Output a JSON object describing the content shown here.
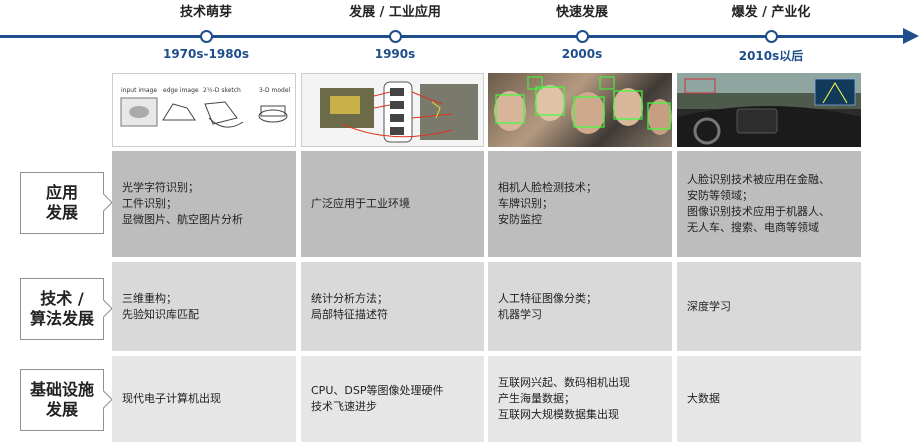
{
  "timeline": {
    "eras": [
      {
        "title": "技术萌芽",
        "year": "1970s-1980s"
      },
      {
        "title": "发展 / 工业应用",
        "year": "1990s"
      },
      {
        "title": "快速发展",
        "year": "2000s"
      },
      {
        "title": "爆发 / 产业化",
        "year": "2010s以后"
      }
    ]
  },
  "thumbs": {
    "t1": {
      "labels": [
        "input image",
        "edge image",
        "2½-D sketch",
        "3-D model"
      ]
    }
  },
  "rows": [
    {
      "label_lines": [
        "应用",
        "发展"
      ],
      "cells": [
        [
          "光学字符识别；",
          "工件识别；",
          "显微图片、航空图片分析"
        ],
        [
          "广泛应用于工业环境"
        ],
        [
          "相机人脸检测技术；",
          "车牌识别；",
          "安防监控"
        ],
        [
          "人脸识别技术被应用在金融、",
          "安防等领域；",
          "图像识别技术应用于机器人、",
          "无人车、搜索、电商等领域"
        ]
      ]
    },
    {
      "label_lines": [
        "技术 /",
        "算法发展"
      ],
      "cells": [
        [
          "三维重构；",
          "先验知识库匹配"
        ],
        [
          "统计分析方法；",
          "局部特征描述符"
        ],
        [
          "人工特征图像分类；",
          "机器学习"
        ],
        [
          "深度学习"
        ]
      ]
    },
    {
      "label_lines": [
        "基础设施",
        "发展"
      ],
      "cells": [
        [
          "现代电子计算机出现"
        ],
        [
          "CPU、DSP等图像处理硬件",
          "技术飞速进步"
        ],
        [
          "互联网兴起、数码相机出现",
          "产生海量数据；",
          "互联网大规模数据集出现"
        ],
        [
          "大数据"
        ]
      ]
    }
  ]
}
